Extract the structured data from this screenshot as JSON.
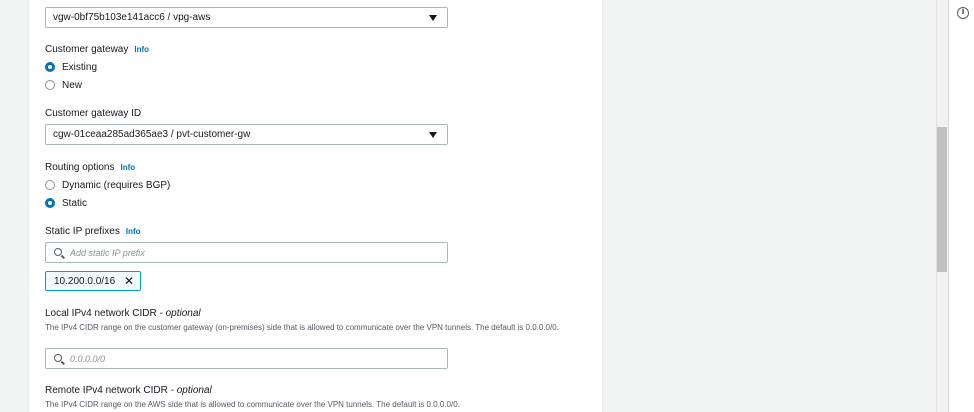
{
  "vpn_gateway": {
    "selected": "vgw-0bf75b103e141acc6 / vpg-aws"
  },
  "customer_gateway": {
    "label": "Customer gateway",
    "info": "Info",
    "options": [
      "Existing",
      "New"
    ],
    "selected": "Existing"
  },
  "customer_gateway_id": {
    "label": "Customer gateway ID",
    "selected": "cgw-01ceaa285ad365ae3 / pvt-customer-gw"
  },
  "routing_options": {
    "label": "Routing options",
    "info": "Info",
    "options": [
      "Dynamic (requires BGP)",
      "Static"
    ],
    "selected": "Static"
  },
  "static_ip_prefixes": {
    "label": "Static IP prefixes",
    "info": "Info",
    "placeholder": "Add static IP prefix",
    "tokens": [
      "10.200.0.0/16"
    ]
  },
  "local_cidr": {
    "label": "Local IPv4 network CIDR",
    "optional": "- optional",
    "description": "The IPv4 CIDR range on the customer gateway (on-premises) side that is allowed to communicate over the VPN tunnels. The default is 0.0.0.0/0.",
    "placeholder": "0.0.0.0/0"
  },
  "remote_cidr": {
    "label": "Remote IPv4 network CIDR",
    "optional": "- optional",
    "description": "The IPv4 CIDR range on the AWS side that is allowed to communicate over the VPN tunnels. The default is 0.0.0.0/0."
  },
  "side_panel": {
    "info_icon": "i"
  },
  "colors": {
    "accent": "#0073bb",
    "token_border": "#00a1c9",
    "background": "#f2f3f3"
  }
}
